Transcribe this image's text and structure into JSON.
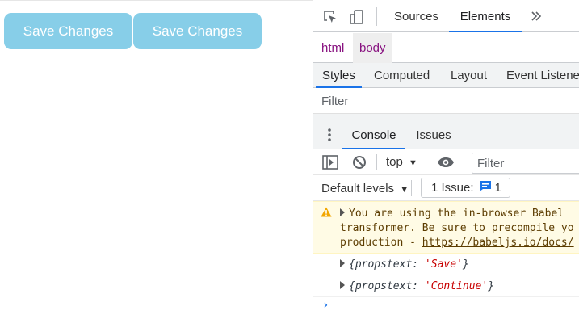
{
  "page": {
    "buttons": [
      {
        "label": "Save Changes"
      },
      {
        "label": "Save Changes"
      }
    ],
    "colors": {
      "button_bg": "#87cee8",
      "button_text": "#ffffff"
    }
  },
  "devtools": {
    "toolbar": {
      "icons": [
        "inspect-element-icon",
        "device-toolbar-icon",
        "more-tabs-icon"
      ],
      "tabs": [
        {
          "label": "Sources",
          "active": false
        },
        {
          "label": "Elements",
          "active": true
        }
      ]
    },
    "breadcrumbs": [
      {
        "label": "html",
        "selected": false
      },
      {
        "label": "body",
        "selected": true
      }
    ],
    "subtabs": [
      {
        "label": "Styles",
        "active": true
      },
      {
        "label": "Computed",
        "active": false
      },
      {
        "label": "Layout",
        "active": false
      },
      {
        "label": "Event Listeners",
        "active": false
      }
    ],
    "styles_filter_placeholder": "Filter",
    "drawer": {
      "tabs": [
        {
          "label": "Console",
          "active": true
        },
        {
          "label": "Issues",
          "active": false
        }
      ]
    },
    "console": {
      "context": "top",
      "filter_placeholder": "Filter",
      "levels_label": "Default levels",
      "issues_label": "1 Issue:",
      "issues_count": "1",
      "warning": {
        "line1": "You are using the in-browser Babel",
        "line2": "transformer. Be sure to precompile yo",
        "line3_text": "production - ",
        "line3_link": "https://babeljs.io/docs/"
      },
      "logs": [
        {
          "key": "{propstext: ",
          "value": "'Save'",
          "close": "}"
        },
        {
          "key": "{propstext: ",
          "value": "'Continue'",
          "close": "}"
        }
      ],
      "prompt_symbol": "›"
    },
    "colors": {
      "accent": "#1a73e8",
      "warning_bg": "#fffbe5",
      "tag_purple": "#881280",
      "string_red": "#c80000"
    }
  }
}
